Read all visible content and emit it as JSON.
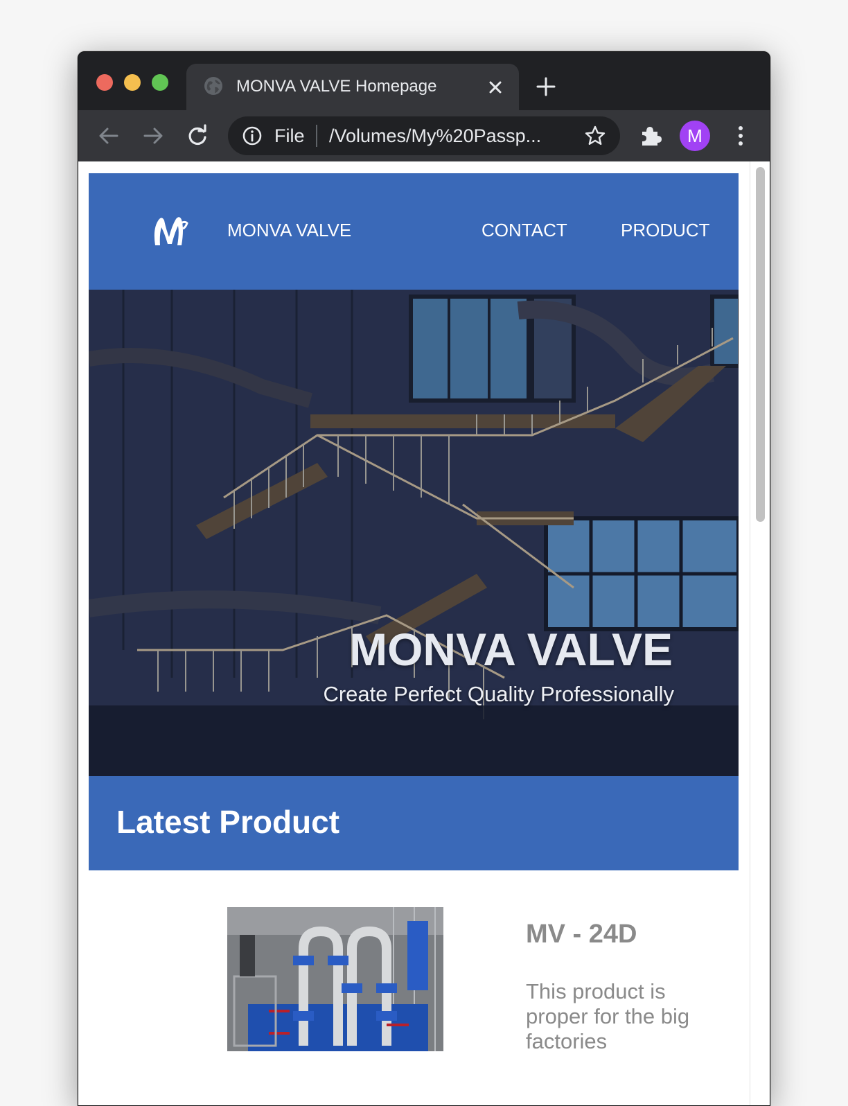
{
  "browser": {
    "tab_title": "MONVA VALVE Homepage",
    "omnibox_scheme": "File",
    "omnibox_url": "/Volumes/My%20Passp...",
    "profile_initial": "M",
    "icons": {
      "traffic_close": "close-window-icon",
      "traffic_minimize": "minimize-window-icon",
      "traffic_zoom": "zoom-window-icon",
      "favicon": "globe-icon",
      "tab_close": "close-icon",
      "new_tab": "plus-icon",
      "back": "arrow-left-icon",
      "forward": "arrow-right-icon",
      "reload": "reload-icon",
      "site_info": "info-icon",
      "bookmark": "star-icon",
      "extensions": "puzzle-icon",
      "menu": "kebab-menu-icon"
    },
    "colors": {
      "frame": "#202124",
      "toolbar": "#35363a",
      "close": "#ed6a5e",
      "minimize": "#f5bf4f",
      "zoom": "#61c554",
      "avatar": "#a142f4"
    }
  },
  "site": {
    "brand": "MONVA VALVE",
    "nav": [
      {
        "label": "CONTACT"
      },
      {
        "label": "PRODUCT"
      }
    ],
    "hero": {
      "title": "MONVA VALVE",
      "subtitle": "Create Perfect Quality Professionally"
    },
    "latest_section": {
      "title": "Latest Product"
    },
    "product": {
      "name": "MV - 24D",
      "description": "This product is proper for the big factories"
    },
    "colors": {
      "header": "#3a69b8",
      "product_text": "#8a8a8a"
    }
  }
}
